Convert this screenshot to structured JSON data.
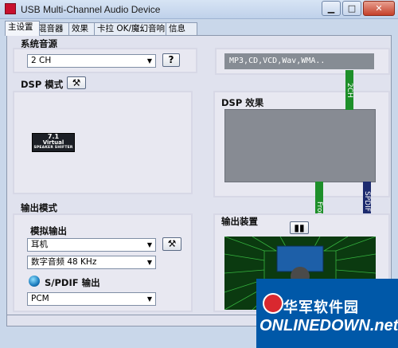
{
  "window": {
    "title": "USB Multi-Channel Audio Device"
  },
  "tabs": [
    "主设置",
    "混音器",
    "效果",
    "卡拉 OK/魔幻音响",
    "信息"
  ],
  "system_source": {
    "label": "系统音源",
    "selected": "2 CH",
    "help_label": "?",
    "formats_text": "MP3,CD,VCD,Wav,WMA.."
  },
  "dsp_mode": {
    "label": "DSP 模式"
  },
  "dsp_effect": {
    "label": "DSP 效果"
  },
  "badge": {
    "line1": "7.1",
    "line2": "Virtual",
    "line3": "SPEAKER SHIFTER"
  },
  "output_mode": {
    "label": "输出模式",
    "analog_label": "模拟输出",
    "analog_selected": "耳机",
    "sample_selected": "数字音频 48 KHz",
    "spdif_label": "S/PDIF 输出",
    "spdif_selected": "PCM"
  },
  "output_device": {
    "label": "输出装置"
  },
  "signal_bars": {
    "ch2": "2CH",
    "front": "Front",
    "spdif_out": "SPDIF OUT"
  },
  "watermark": {
    "top": "华军软件园",
    "bottom": "ONLINEDOWN.net"
  }
}
